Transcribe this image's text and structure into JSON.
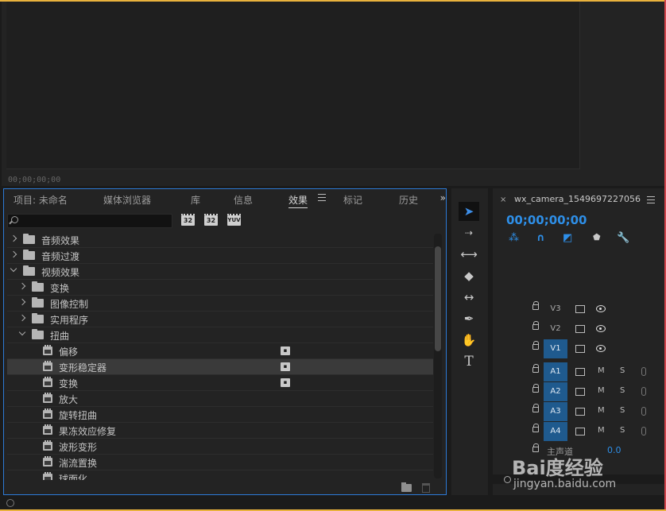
{
  "monitor": {
    "timecode": "00;00;00;00"
  },
  "effects": {
    "tabs": [
      {
        "label": "项目: 未命名"
      },
      {
        "label": "媒体浏览器"
      },
      {
        "label": "库"
      },
      {
        "label": "信息"
      },
      {
        "label": "效果"
      },
      {
        "label": "标记"
      },
      {
        "label": "历史"
      }
    ],
    "overflow": "»",
    "search": {
      "value": "",
      "placeholder": ""
    },
    "filters": [
      {
        "label": "32",
        "icon": "accelerated-effects-icon"
      },
      {
        "label": "32",
        "icon": "32bit-effects-icon"
      },
      {
        "label": "YUV",
        "icon": "yuv-effects-icon"
      }
    ],
    "tree": [
      {
        "label": "音频效果",
        "kind": "folder",
        "level": 0,
        "expanded": false
      },
      {
        "label": "音频过渡",
        "kind": "folder",
        "level": 0,
        "expanded": false
      },
      {
        "label": "视频效果",
        "kind": "folder",
        "level": 0,
        "expanded": true
      },
      {
        "label": "变换",
        "kind": "folder",
        "level": 1,
        "expanded": false
      },
      {
        "label": "图像控制",
        "kind": "folder",
        "level": 1,
        "expanded": false
      },
      {
        "label": "实用程序",
        "kind": "folder",
        "level": 1,
        "expanded": false
      },
      {
        "label": "扭曲",
        "kind": "folder",
        "level": 1,
        "expanded": true
      },
      {
        "label": "偏移",
        "kind": "effect",
        "level": 2,
        "accelerated": true
      },
      {
        "label": "变形稳定器",
        "kind": "effect",
        "level": 2,
        "accelerated": true,
        "selected": true
      },
      {
        "label": "变换",
        "kind": "effect",
        "level": 2,
        "accelerated": true
      },
      {
        "label": "放大",
        "kind": "effect",
        "level": 2
      },
      {
        "label": "旋转扭曲",
        "kind": "effect",
        "level": 2
      },
      {
        "label": "果冻效应修复",
        "kind": "effect",
        "level": 2
      },
      {
        "label": "波形变形",
        "kind": "effect",
        "level": 2
      },
      {
        "label": "湍流置换",
        "kind": "effect",
        "level": 2
      },
      {
        "label": "球面化",
        "kind": "effect",
        "level": 2
      }
    ]
  },
  "timeline": {
    "close": "×",
    "title": "wx_camera_1549697227056",
    "timecode": "00;00;00;00",
    "video_tracks": [
      {
        "name": "V3",
        "targeted": false
      },
      {
        "name": "V2",
        "targeted": false
      },
      {
        "name": "V1",
        "targeted": true
      }
    ],
    "audio_tracks": [
      {
        "name": "A1",
        "m": "M",
        "s": "S"
      },
      {
        "name": "A2",
        "m": "M",
        "s": "S"
      },
      {
        "name": "A3",
        "m": "M",
        "s": "S"
      },
      {
        "name": "A4",
        "m": "M",
        "s": "S"
      }
    ],
    "master_label": "主声道",
    "master_value": "0.0"
  },
  "watermark": {
    "brand": "Bai度经验",
    "url": "jingyan.baidu.com"
  },
  "colors": {
    "accent": "#2e8fe8",
    "panel_focus": "#2c7ad6",
    "track_target": "#1f5a8e",
    "frame": "#e9b23d"
  }
}
